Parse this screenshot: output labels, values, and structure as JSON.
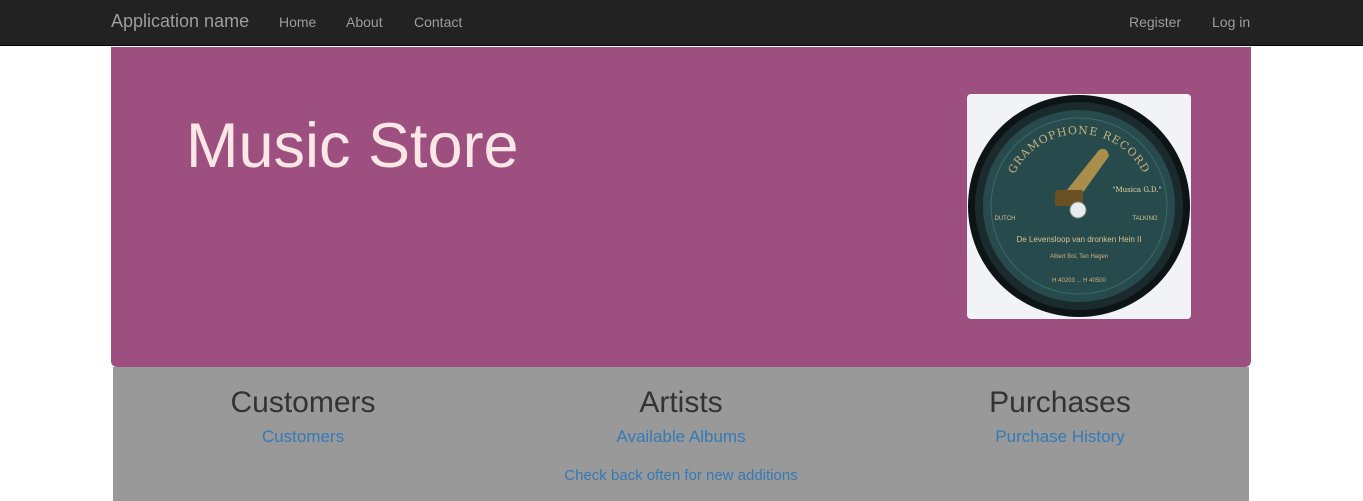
{
  "navbar": {
    "brand": "Application name",
    "links": [
      "Home",
      "About",
      "Contact"
    ],
    "account": {
      "register": "Register",
      "login": "Log in"
    }
  },
  "jumbotron": {
    "title": "Music Store",
    "record": {
      "brand_text": "GRAMOPHONE RECORD",
      "label_top": "\"Musica G.D.\"",
      "left_small": "DUTCH",
      "right_small": "TALKING",
      "song": "De Levensloop van dronken Hein II",
      "artist": "Albert Bol, Ten Hagen",
      "catalog": "H 40203 ... H 40500"
    }
  },
  "sections": [
    {
      "title": "Customers",
      "link": "Customers"
    },
    {
      "title": "Artists",
      "link": "Available Albums"
    },
    {
      "title": "Purchases",
      "link": "Purchase History"
    }
  ],
  "footer_note": "Check back often for new additions",
  "colors": {
    "navbar_bg": "#222222",
    "nav_text": "#9d9d9d",
    "jumbotron_bg": "#9d5080",
    "title_text": "#fde6e6",
    "content_bg": "#999999",
    "link": "#337ab7"
  }
}
